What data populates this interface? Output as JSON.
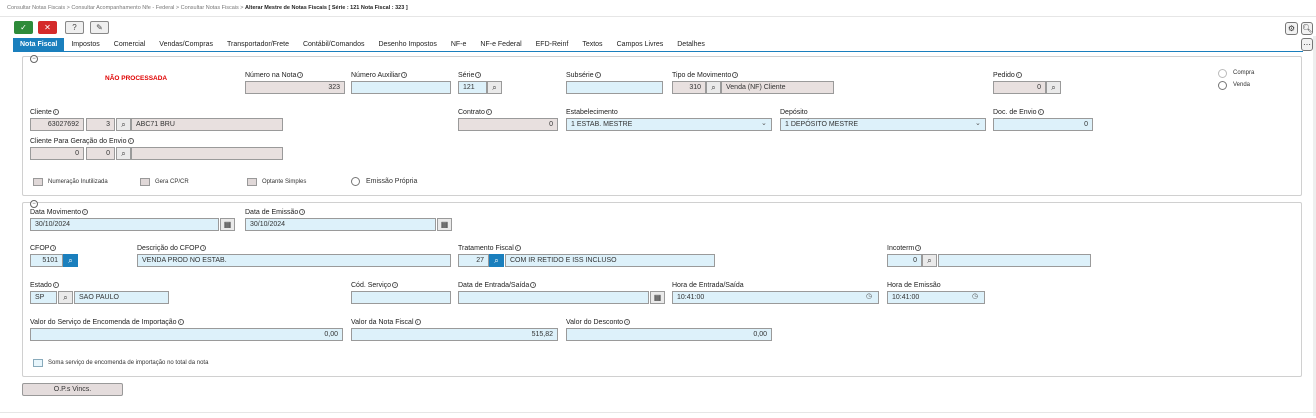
{
  "breadcrumb": {
    "item1": "Consultar Notas Fiscais",
    "item2": "Consultar Acompanhamento Nfe - Federal",
    "item3": "Consultar Notas Fiscais",
    "current": "Alterar Mestre de Notas Fiscais [ Série : 121 Nota Fiscal : 323 ]",
    "sep": ">"
  },
  "toolbar": {
    "confirm": "✓",
    "cancel": "✕",
    "help": "?",
    "tool": "✎"
  },
  "tabs": [
    "Nota Fiscal",
    "Impostos",
    "Comercial",
    "Vendas/Compras",
    "Transportador/Frete",
    "Contábil/Comandos",
    "Desenho Impostos",
    "NF-e",
    "NF-e Federal",
    "EFD-Reinf",
    "Textos",
    "Campos Livres",
    "Detalhes"
  ],
  "status": "NÃO PROCESSADA",
  "header": {
    "numero_nota": {
      "label": "Número na Nota",
      "value": "323"
    },
    "numero_auxiliar": {
      "label": "Número Auxiliar",
      "value": ""
    },
    "serie": {
      "label": "Série",
      "value": "121"
    },
    "subserie": {
      "label": "Subsérie",
      "value": ""
    },
    "tipo_movimento": {
      "label": "Tipo de Movimento",
      "code": "310",
      "desc": "Venda (NF) Cliente"
    },
    "pedido": {
      "label": "Pedido",
      "value": "0"
    },
    "radio": {
      "compra": "Compra",
      "venda": "Venda"
    },
    "cliente": {
      "label": "Cliente",
      "code": "63027692",
      "seq": "3",
      "name": "ABC71 BRU"
    },
    "contrato": {
      "label": "Contrato",
      "value": "0"
    },
    "estabelecimento": {
      "label": "Estabelecimento",
      "value": "1 ESTAB. MESTRE"
    },
    "deposito": {
      "label": "Depósito",
      "value": "1 DEPÓSITO MESTRE"
    },
    "doc_envio": {
      "label": "Doc. de Envio",
      "value": "0"
    },
    "cliente_envio": {
      "label": "Cliente Para Geração do Envio",
      "code": "0",
      "seq": "0",
      "name": ""
    },
    "checks": {
      "numeracao": "Numeração Inutilizada",
      "gera_cp": "Gera CP/CR",
      "optante": "Optante Simples",
      "emissao": "Emissão Própria"
    }
  },
  "detail": {
    "data_movimento": {
      "label": "Data Movimento",
      "value": "30/10/2024"
    },
    "data_emissao": {
      "label": "Data de Emissão",
      "value": "30/10/2024"
    },
    "cfop": {
      "label": "CFOP",
      "value": "5101"
    },
    "desc_cfop": {
      "label": "Descrição do CFOP",
      "value": "VENDA PROD NO ESTAB."
    },
    "tratamento": {
      "label": "Tratamento Fiscal",
      "code": "27",
      "desc": "COM IR RETIDO E ISS INCLUSO"
    },
    "incoterm": {
      "label": "Incoterm",
      "value": "0"
    },
    "estado": {
      "label": "Estado",
      "code": "SP",
      "name": "SAO PAULO"
    },
    "cod_servico": {
      "label": "Cód. Serviço",
      "value": ""
    },
    "data_entrada": {
      "label": "Data de Entrada/Saída",
      "value": ""
    },
    "hora_entrada": {
      "label": "Hora de Entrada/Saída",
      "value": "10:41:00"
    },
    "hora_emissao": {
      "label": "Hora de Emissão",
      "value": "10:41:00"
    },
    "valor_servico": {
      "label": "Valor do Serviço de Encomenda de Importação",
      "value": "0,00"
    },
    "valor_nota": {
      "label": "Valor da Nota Fiscal",
      "value": "515,82"
    },
    "valor_desconto": {
      "label": "Valor do Desconto",
      "value": "0,00"
    },
    "soma_check": "Soma serviço de encomenda de importação no total da nota"
  },
  "ops_button": "O.P.s Vincs.",
  "colors": {
    "accent": "#1a7fbd",
    "status_red": "#e00000",
    "field_blue": "#ddf1fa",
    "field_grey": "#e8e0df"
  }
}
